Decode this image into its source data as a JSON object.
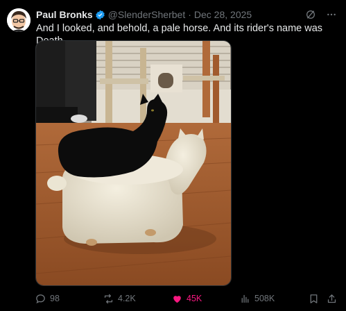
{
  "author": {
    "display_name": "Paul Bronks",
    "handle": "@SlenderSherbet",
    "separator": "·",
    "date": "Dec 28, 2025",
    "verified": true
  },
  "post": {
    "text": "And I looked, and behold, a pale horse. And its rider's name was Death."
  },
  "header_icons": [
    "grok-icon",
    "more-icon"
  ],
  "metrics": {
    "replies": "98",
    "reposts": "4.2K",
    "likes": "45K",
    "views": "508K"
  },
  "action_icons": [
    "reply-icon",
    "repost-icon",
    "like-icon",
    "views-icon",
    "bookmark-icon",
    "share-icon"
  ],
  "colors": {
    "background": "#000000",
    "verified": "#1d9bf0",
    "like_active": "#f91880",
    "muted": "#71767b"
  }
}
